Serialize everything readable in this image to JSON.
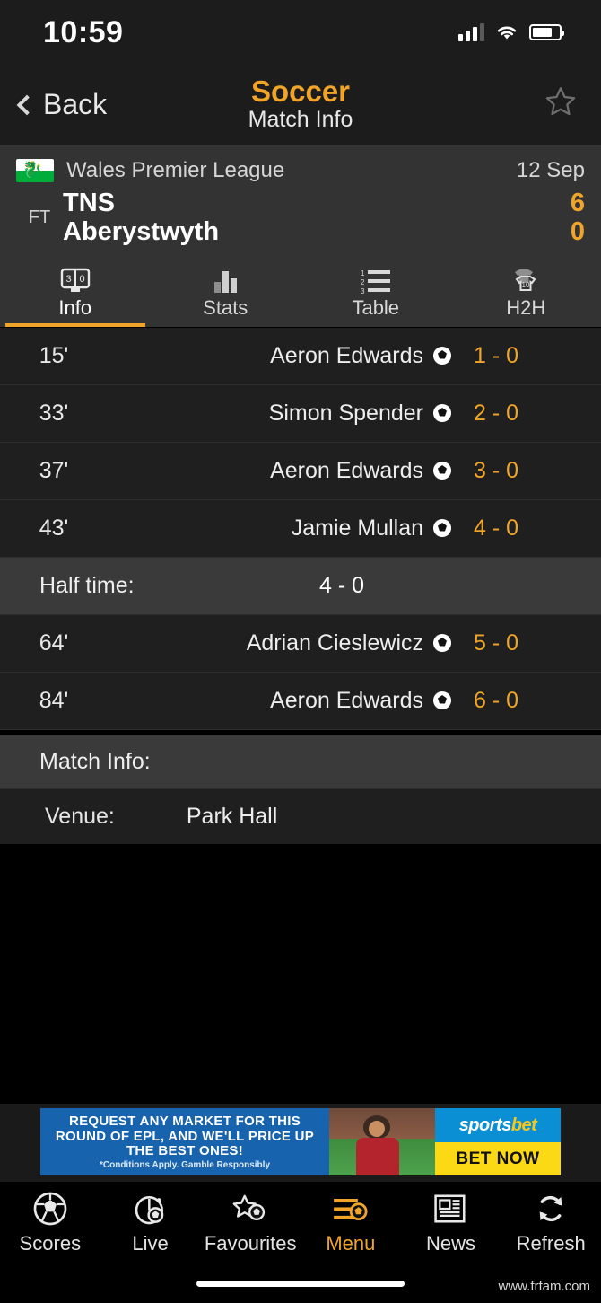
{
  "status_bar": {
    "time": "10:59",
    "signal_icon": "signal-bars-icon",
    "wifi_icon": "wifi-icon",
    "battery_icon": "battery-icon"
  },
  "nav": {
    "back_label": "Back",
    "title": "Soccer",
    "subtitle": "Match Info",
    "favourite_icon": "star-outline-icon",
    "back_icon": "chevron-left-icon"
  },
  "match": {
    "league": "Wales Premier League",
    "league_flag": "wales-flag-icon",
    "date": "12 Sep",
    "status": "FT",
    "home_team": "TNS",
    "away_team": "Aberystwyth",
    "home_score": "6",
    "away_score": "0"
  },
  "tabs": [
    {
      "label": "Info",
      "icon": "scoreboard-icon",
      "active": true
    },
    {
      "label": "Stats",
      "icon": "bar-chart-icon",
      "active": false
    },
    {
      "label": "Table",
      "icon": "numbered-list-icon",
      "active": false
    },
    {
      "label": "H2H",
      "icon": "jerseys-icon",
      "active": false
    }
  ],
  "events": [
    {
      "minute": "15'",
      "player": "Aeron Edwards",
      "icon": "soccer-ball-icon",
      "score": "1 - 0"
    },
    {
      "minute": "33'",
      "player": "Simon Spender",
      "icon": "soccer-ball-icon",
      "score": "2 - 0"
    },
    {
      "minute": "37'",
      "player": "Aeron Edwards",
      "icon": "soccer-ball-icon",
      "score": "3 - 0"
    },
    {
      "minute": "43'",
      "player": "Jamie Mullan",
      "icon": "soccer-ball-icon",
      "score": "4 - 0"
    }
  ],
  "half_time": {
    "label": "Half time:",
    "score": "4 - 0"
  },
  "events_second_half": [
    {
      "minute": "64'",
      "player": "Adrian Cieslewicz",
      "icon": "soccer-ball-icon",
      "score": "5 - 0"
    },
    {
      "minute": "84'",
      "player": "Aeron Edwards",
      "icon": "soccer-ball-icon",
      "score": "6 - 0"
    }
  ],
  "match_info": {
    "heading": "Match Info:",
    "rows": [
      {
        "key": "Venue:",
        "value": "Park Hall"
      }
    ]
  },
  "ad": {
    "line1": "REQUEST ANY MARKET FOR THIS",
    "line2": "ROUND OF EPL, AND WE'LL PRICE UP",
    "line3": "THE BEST ONES!",
    "disclaimer": "*Conditions Apply. Gamble Responsibly",
    "brand_part1": "sports",
    "brand_part2": "bet",
    "cta": "BET NOW"
  },
  "bottom_nav": [
    {
      "label": "Scores",
      "icon": "soccer-ball-icon",
      "active": false
    },
    {
      "label": "Live",
      "icon": "stopwatch-ball-icon",
      "active": false
    },
    {
      "label": "Favourites",
      "icon": "star-ball-icon",
      "active": false
    },
    {
      "label": "Menu",
      "icon": "menu-ball-icon",
      "active": true
    },
    {
      "label": "News",
      "icon": "newspaper-icon",
      "active": false
    },
    {
      "label": "Refresh",
      "icon": "refresh-icon",
      "active": false
    }
  ],
  "watermark": "www.frfam.com",
  "colors": {
    "accent": "#f0a52a",
    "header_bg": "#333333",
    "row_bg": "#1f1f1f",
    "highlight_row_bg": "#3a3a3a"
  }
}
